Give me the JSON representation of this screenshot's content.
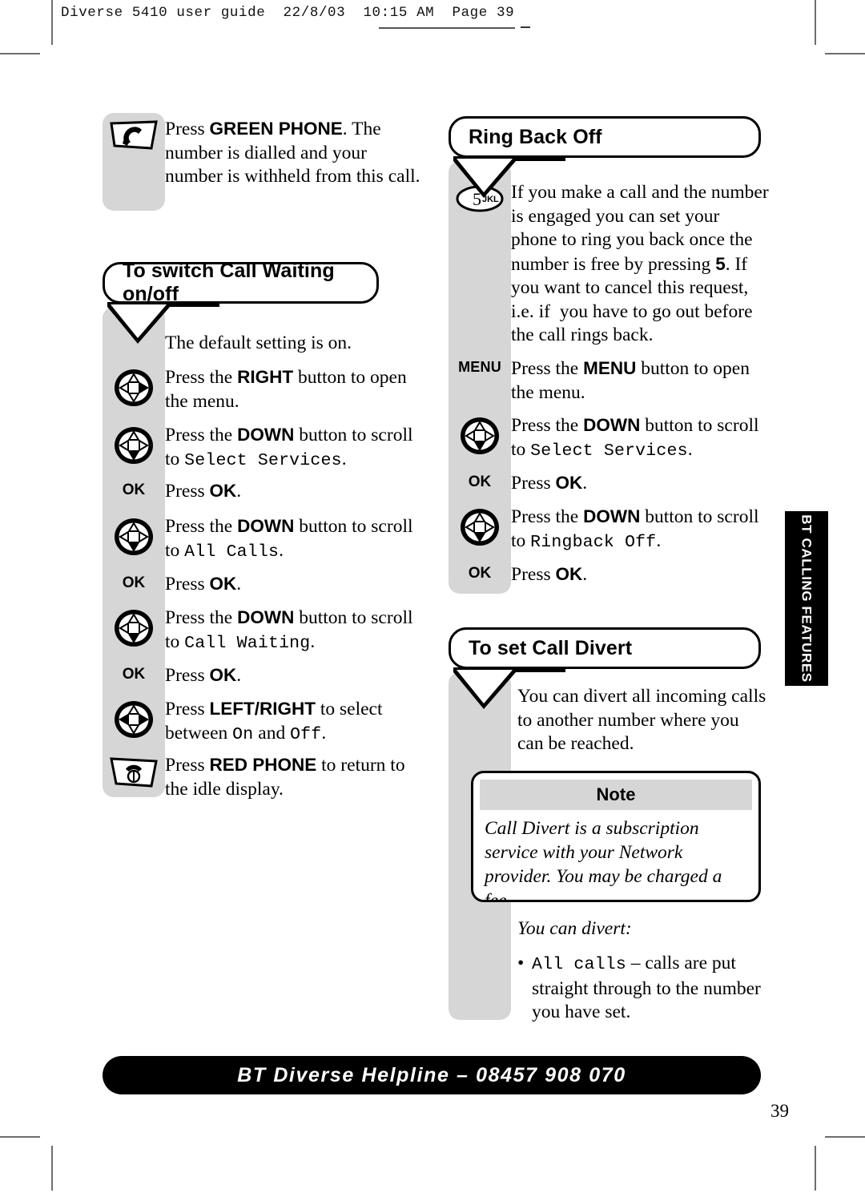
{
  "print_header": "Diverse 5410 user guide  22/8/03  10:15 AM  Page 39",
  "side_tab": {
    "label": "BT CALLING FEATURES"
  },
  "footer": {
    "label": "BT Diverse Helpline – 08457 908 070"
  },
  "page_number": "39",
  "colors": {
    "grey_bar": "#d6d6d6",
    "black": "#000000",
    "paper": "#ffffff"
  },
  "left_column": {
    "intro_step": {
      "icon": "green-phone-key-icon",
      "text_parts": [
        "Press ",
        "GREEN PHONE",
        ". The number is dialled and your number is withheld from this call."
      ],
      "text": "Press GREEN PHONE. The number is dialled and your number is withheld from this call."
    },
    "heading": "To switch Call Waiting on/off",
    "steps": [
      {
        "icon": "",
        "icon_label": "",
        "text": "The default setting is on."
      },
      {
        "icon": "nav-pad-right-icon",
        "icon_label": "",
        "text": "Press the RIGHT button to open the menu."
      },
      {
        "icon": "nav-pad-down-icon",
        "icon_label": "",
        "text": "Press the DOWN button to scroll to Select Services."
      },
      {
        "icon": "ok-key-icon",
        "icon_label": "OK",
        "text": "Press OK."
      },
      {
        "icon": "nav-pad-down-icon",
        "icon_label": "",
        "text": "Press the DOWN button to scroll to All Calls."
      },
      {
        "icon": "ok-key-icon",
        "icon_label": "OK",
        "text": "Press OK."
      },
      {
        "icon": "nav-pad-down-icon",
        "icon_label": "",
        "text": "Press the DOWN button to scroll to Call Waiting."
      },
      {
        "icon": "ok-key-icon",
        "icon_label": "OK",
        "text": "Press OK."
      },
      {
        "icon": "nav-pad-left-right-icon",
        "icon_label": "",
        "text": "Press LEFT/RIGHT to select between On and Off."
      },
      {
        "icon": "red-phone-key-icon",
        "icon_label": "",
        "text": "Press RED PHONE to return to the idle display."
      }
    ]
  },
  "right_column": {
    "heading_ringback": "Ring Back Off",
    "ringback_intro": {
      "icon": "key-5-jkl-icon",
      "key_digit": "5",
      "key_letters": "JKL",
      "text": "If you make a call and the number is engaged you can set your phone to ring you back once the number is free by pressing 5. If you want to cancel this request, i.e. if  you have to go out before the call rings back."
    },
    "ringback_steps": [
      {
        "icon": "menu-key-icon",
        "icon_label": "MENU",
        "text": "Press the MENU button to open the menu."
      },
      {
        "icon": "nav-pad-down-icon",
        "icon_label": "",
        "text": "Press the DOWN button to scroll to Select Services."
      },
      {
        "icon": "ok-key-icon",
        "icon_label": "OK",
        "text": "Press OK."
      },
      {
        "icon": "nav-pad-down-icon",
        "icon_label": "",
        "text": "Press the DOWN button to scroll to Ringback Off."
      },
      {
        "icon": "ok-key-icon",
        "icon_label": "OK",
        "text": "Press OK."
      }
    ],
    "heading_calldivert": "To set Call Divert",
    "calldivert_intro": "You can divert all incoming calls to another number where you can be reached.",
    "note": {
      "title": "Note",
      "body": "Call Divert is a subscription service with your Network provider. You may be charged a fee."
    },
    "divert_lead": "You can divert:",
    "divert_bullets": [
      {
        "lcd": "All calls",
        "rest": " – calls are put straight through to the number you have set."
      }
    ]
  },
  "lcd_terms": {
    "select_services": "Select Services",
    "all_calls": "All Calls",
    "call_waiting": "Call Waiting",
    "on": "On",
    "off": "Off",
    "ringback_off": "Ringback Off",
    "all_calls_lower": "All calls"
  }
}
